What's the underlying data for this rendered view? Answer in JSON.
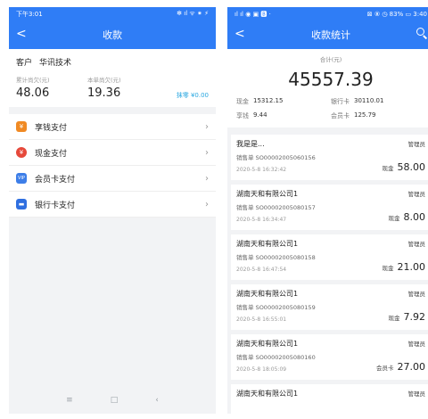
{
  "left": {
    "status": {
      "time": "下午3:01",
      "icons": "✻ ıl ᯤ ⁕ ⚡"
    },
    "nav": {
      "title": "收款",
      "back": "<"
    },
    "customer": {
      "label": "客户",
      "name": "华讯技术"
    },
    "accumulated": {
      "label": "累计尚欠(元)",
      "value": "48.06"
    },
    "current": {
      "label": "本单尚欠(元)",
      "value": "19.36"
    },
    "change": "抹零 ¥0.00",
    "payments": [
      {
        "label": "享钱支付",
        "icon": "piggy-bank-icon",
        "color": "#f08a24"
      },
      {
        "label": "现金支付",
        "icon": "cash-icon",
        "color": "#e6493b"
      },
      {
        "label": "会员卡支付",
        "icon": "vip-card-icon",
        "color": "#3d7ee8"
      },
      {
        "label": "银行卡支付",
        "icon": "bank-card-icon",
        "color": "#2f6fe0"
      }
    ],
    "bottom_nav": [
      "≡",
      "□",
      "‹"
    ]
  },
  "right": {
    "status": {
      "left": "ıl ıl ◉ ▣ 🅱 ·",
      "right": "⊠ ⑧ ◷ 83% ▭ 3:40"
    },
    "nav": {
      "title": "收款统计",
      "back": "<"
    },
    "total": {
      "label": "合计(元)",
      "value": "45557.39"
    },
    "breakdown": [
      {
        "key": "现金",
        "value": "15312.15"
      },
      {
        "key": "银行卡",
        "value": "30110.01"
      },
      {
        "key": "享钱",
        "value": "9.44"
      },
      {
        "key": "会员卡",
        "value": "125.79"
      }
    ],
    "records": [
      {
        "customer": "我是是...",
        "role": "管理员",
        "order": "销售单 SO00002005060156",
        "time": "2020-5-8 16:32:42",
        "method": "现金",
        "amount": "58.00"
      },
      {
        "customer": "湖南天和有限公司1",
        "role": "管理员",
        "order": "销售单 SO00002005080157",
        "time": "2020-5-8 16:34:47",
        "method": "现金",
        "amount": "8.00"
      },
      {
        "customer": "湖南天和有限公司1",
        "role": "管理员",
        "order": "销售单 SO00002005080158",
        "time": "2020-5-8 16:47:54",
        "method": "现金",
        "amount": "21.00"
      },
      {
        "customer": "湖南天和有限公司1",
        "role": "管理员",
        "order": "销售单 SO00002005080159",
        "time": "2020-5-8 16:55:01",
        "method": "现金",
        "amount": "7.92"
      },
      {
        "customer": "湖南天和有限公司1",
        "role": "管理员",
        "order": "销售单 SO00002005080160",
        "time": "2020-5-8 18:05:09",
        "method": "会员卡",
        "amount": "27.00"
      },
      {
        "customer": "湖南天和有限公司1",
        "role": "管理员",
        "order": "",
        "time": "",
        "method": "",
        "amount": ""
      }
    ]
  }
}
